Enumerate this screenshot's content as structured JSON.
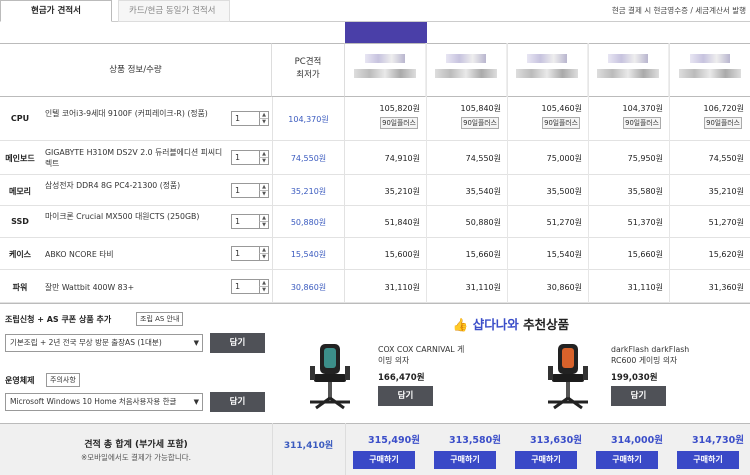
{
  "tabs": {
    "active": "현금가 견적서",
    "inactive": "카드/현금 동일가 견적서"
  },
  "top_right": "현금 결제 시 현금영수증 / 세금계산서 발행",
  "header": {
    "product_col": "상품 정보/수량",
    "pc_col_line1": "PC견적",
    "pc_col_line2": "최저가"
  },
  "rows": [
    {
      "category": "CPU",
      "name": "인텔 코어i3-9세대 9100F (커피레이크-R) (정품)",
      "qty": "1",
      "pc_price": "104,370원",
      "prices": [
        "105,820원",
        "105,840원",
        "105,460원",
        "104,370원",
        "106,720원"
      ],
      "badges": [
        "90일플러스",
        "90일플러스",
        "90일플러스",
        "90일플러스",
        "90일플러스"
      ]
    },
    {
      "category": "메인보드",
      "name": "GIGABYTE H310M DS2V 2.0 듀러블에디션 피씨디렉트",
      "qty": "1",
      "pc_price": "74,550원",
      "prices": [
        "74,910원",
        "74,550원",
        "75,000원",
        "75,950원",
        "74,550원"
      ],
      "badges": []
    },
    {
      "category": "메모리",
      "name": "삼성전자 DDR4 8G PC4-21300 (정품)",
      "qty": "1",
      "pc_price": "35,210원",
      "prices": [
        "35,210원",
        "35,540원",
        "35,500원",
        "35,580원",
        "35,210원"
      ],
      "badges": []
    },
    {
      "category": "SSD",
      "name": "마이크론 Crucial MX500 대원CTS (250GB)",
      "qty": "1",
      "pc_price": "50,880원",
      "prices": [
        "51,840원",
        "50,880원",
        "51,270원",
        "51,370원",
        "51,270원"
      ],
      "badges": []
    },
    {
      "category": "케이스",
      "name": "ABKO NCORE 타비",
      "qty": "1",
      "pc_price": "15,540원",
      "prices": [
        "15,600원",
        "15,660원",
        "15,540원",
        "15,660원",
        "15,620원"
      ],
      "badges": []
    },
    {
      "category": "파워",
      "name": "잘만 Wattbit 400W 83+",
      "qty": "1",
      "pc_price": "30,860원",
      "prices": [
        "31,110원",
        "31,110원",
        "30,860원",
        "31,110원",
        "31,360원"
      ],
      "badges": []
    }
  ],
  "assembly": {
    "label": "조립신청 + AS 쿠폰 상품 추가",
    "info_btn": "조립 AS 안내",
    "select": "기본조립 + 2년 전국 무상 방문 출장AS (1대분)",
    "add_btn": "담기"
  },
  "os": {
    "label": "운영체제",
    "note_btn": "주의사항",
    "select": "Microsoft Windows 10 Home 처음사용자용 한글",
    "add_btn": "담기"
  },
  "reco": {
    "title_brand": "샵다나와",
    "title_rest": " 추천상품",
    "items": [
      {
        "name": "COX COX CARNIVAL 게이밍 의자",
        "price": "166,470원",
        "btn": "담기"
      },
      {
        "name": "darkFlash darkFlash RC600 게이밍 의자",
        "price": "199,030원",
        "btn": "담기"
      }
    ]
  },
  "total": {
    "label": "견적 총 합계 (부가세 포함)",
    "sub": "※모바일에서도 결제가 가능합니다.",
    "pc_total": "311,410원",
    "shop_totals": [
      "315,490원",
      "313,580원",
      "313,630원",
      "314,000원",
      "314,730원"
    ],
    "buy_label": "구매하기"
  },
  "colors": {
    "accent": "#3a49c7",
    "pc_price": "#3b5bbf",
    "dark_button": "#4f5157"
  }
}
